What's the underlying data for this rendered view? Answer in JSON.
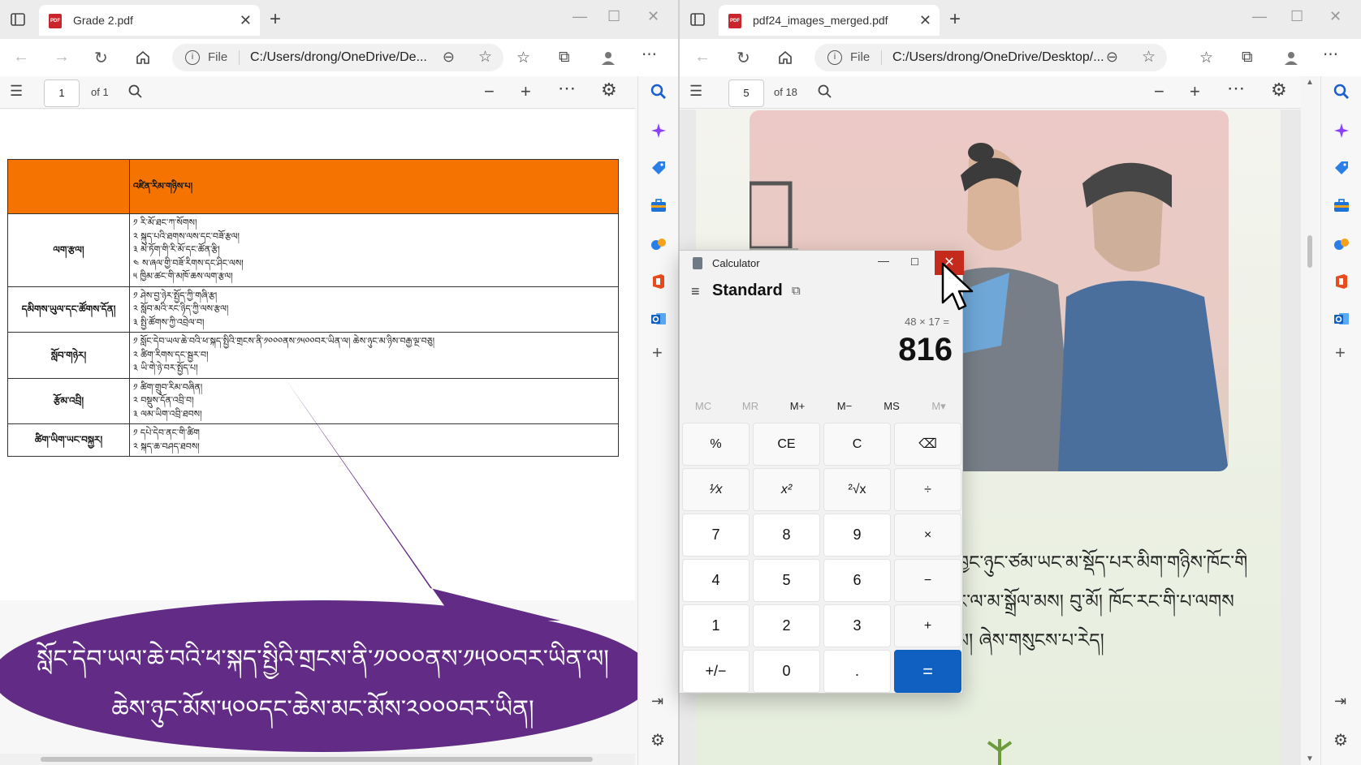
{
  "left_window": {
    "tab_title": "Grade 2.pdf",
    "address": {
      "scheme": "File",
      "path": "C:/Users/drong/OneDrive/De..."
    },
    "pdf_toolbar": {
      "page": "1",
      "of": "of 1"
    },
    "table": {
      "header": "འཛིན་རིམ་གཉིས་པ།",
      "rows": [
        {
          "label": "ལག་རྩལ།",
          "lines": [
            "༡ རི་མོ་ཐང་ཀ་སོགས།",
            "༢ སྐུད་པའི་ཐགས་ལས་དང་བཟོ་རྩལ།",
            "༣ མེ་ཏོག་གི་རི་མོ་དང་ཚོན་རྩི།",
            "༤ ས་ཞལ་གྱི་བཟོ་རིགས་དང་ཤིང་ལས།",
            "༥ ཁྱིམ་ཚང་གི་མཁོ་ཆས་ལག་རྩལ།"
          ]
        },
        {
          "label": "དམིགས་ཡུལ་དང་ཚོགས་དོན།",
          "lines": [
            "༡ ཤེས་བྱ་ཉེར་སྤྱོད་ཀྱི་གཞི་རྩ།",
            "༢ སློབ་མའི་རང་ཉིད་ཀྱི་ལས་རྩལ།",
            "༣ སྤྱི་ཚོགས་ཀྱི་འབྲེལ་བ།"
          ]
        },
        {
          "label": "སློབ་གཉེར།",
          "lines": [
            "༡ སློང་དེབ་ཡལ་ཆེ་བའི་ཕ་སྐད་སྤྱིའི་གྲངས་ནི་༡༠༠༠ནས་༡༥༠༠བར་ཡིན་ལ། ཆེས་ཉུང་མ་ཉིས་བརྒྱ་ལྔ་བཅུ།",
            "༢ ཚིག་རིགས་དང་སྦྱར་བ།",
            "༣ ཡི་གེ་ཉེ་བར་སྤྱོད་པ།"
          ]
        },
        {
          "label": "རྩོམ་འབྲི།",
          "lines": [
            "༡ ཚིག་གྲུབ་རིམ་བཞིན།",
            "༢ བསྡུས་དོན་འབྲི་བ།",
            "༣ ལམ་ཡིག་འབྲི་ཐབས།"
          ]
        },
        {
          "label": "ཚིག་ཡིག་ཡང་བསྐྱར།",
          "lines": [
            "༡ དཔེ་དེབ་ནང་གི་ཚིག",
            "༢ སྐད་ཆ་བཤད་ཐབས།"
          ]
        }
      ]
    },
    "callout": {
      "line1": "སློང་དེབ་ཡལ་ཆེ་བའི་ཕ་སྐད་སྤྱིའི་གྲངས་ནི་༡༠༠༠ནས་༡༥༠༠བར་ཡིན་ལ།",
      "line2": "ཆེས་ཉུང་མོས་༥༠༠དང་ཆེས་མང་མོས་༢༠༠༠བར་ཡིན།"
    }
  },
  "right_window": {
    "tab_title": "pdf24_images_merged.pdf",
    "address": {
      "scheme": "File",
      "path": "C:/Users/drong/OneDrive/Desktop/..."
    },
    "pdf_toolbar": {
      "page": "5",
      "of": "of 18"
    },
    "text_lines": [
      "ཁྱང་ཉུང་ཙམ་ཡང་མ་སྡོད་པར་མིག་གཉིས་ཁོང་གི",
      "ང་ལ་མ་སྒྲོལ་མས། བུ་མོ། ཁོང་རང་གི་པ་ལགས",
      "མ། ཞེས་གསུངས་པ་རེད།"
    ]
  },
  "calculator": {
    "title": "Calculator",
    "mode": "Standard",
    "expression": "48 × 17 =",
    "result": "816",
    "memory": [
      "MC",
      "MR",
      "M+",
      "M−",
      "MS",
      "M▾"
    ],
    "keys": [
      "%",
      "CE",
      "C",
      "⌫",
      "¹⁄x",
      "x²",
      "²√x",
      "÷",
      "7",
      "8",
      "9",
      "×",
      "4",
      "5",
      "6",
      "−",
      "1",
      "2",
      "3",
      "+",
      "+/−",
      "0",
      ".",
      "="
    ]
  },
  "colors": {
    "accent": "#0f60c0",
    "close_red": "#c42b1c",
    "callout": "#612b86",
    "table_header": "#f57300"
  }
}
